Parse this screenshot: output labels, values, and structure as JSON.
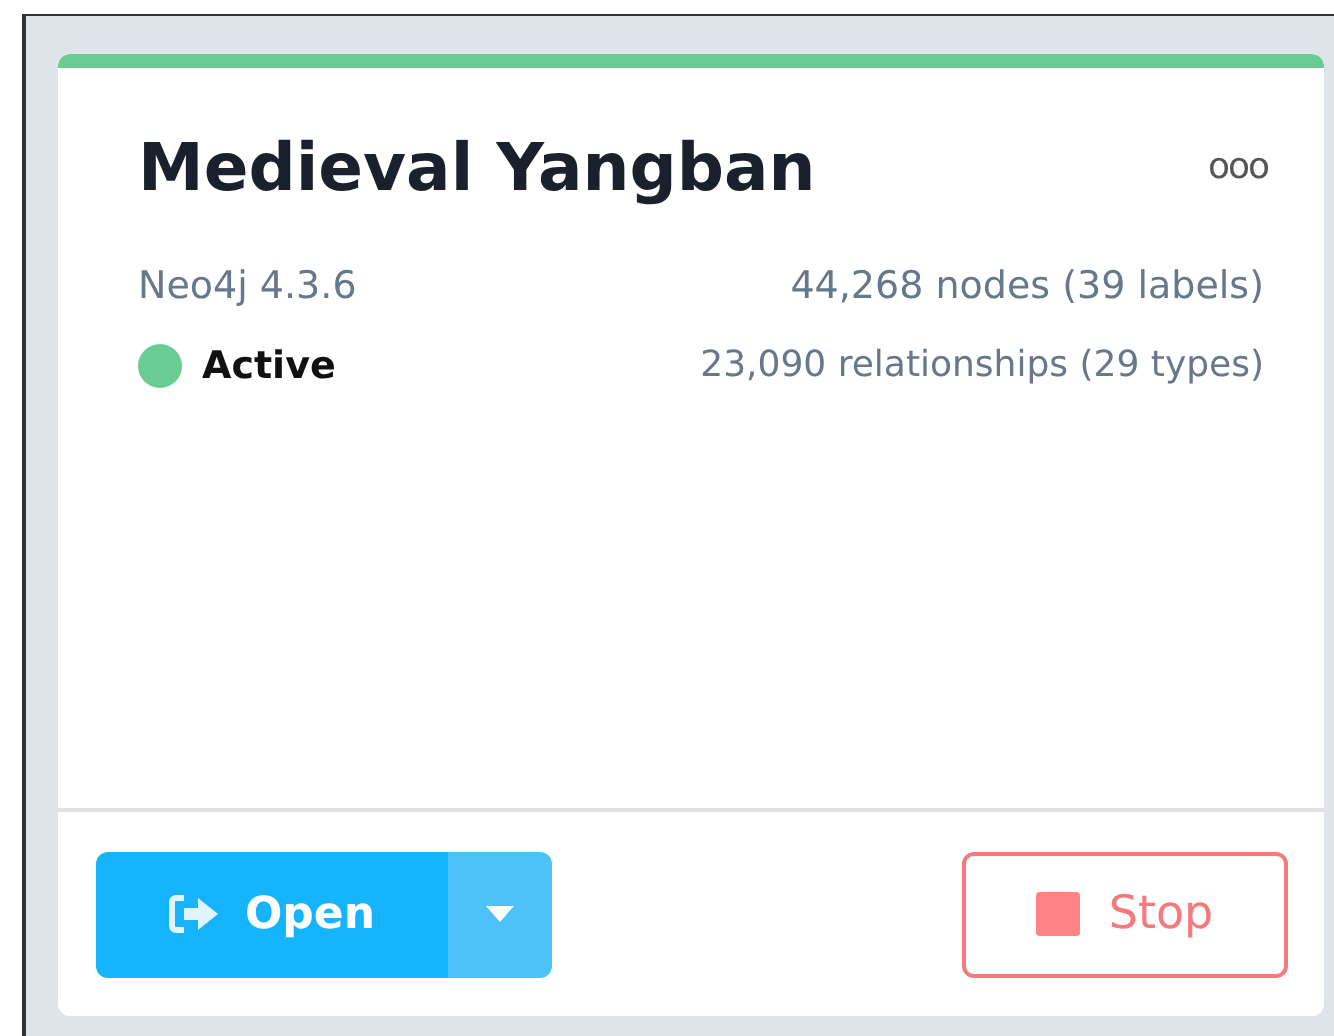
{
  "card": {
    "title": "Medieval Yangban",
    "menu": "ooo",
    "version": "Neo4j 4.3.6",
    "status": {
      "label": "Active",
      "active": true
    },
    "nodes": "44,268 nodes (39 labels)",
    "relationships": "23,090 relationships (29 types)"
  },
  "buttons": {
    "open": "Open",
    "stop": "Stop"
  }
}
